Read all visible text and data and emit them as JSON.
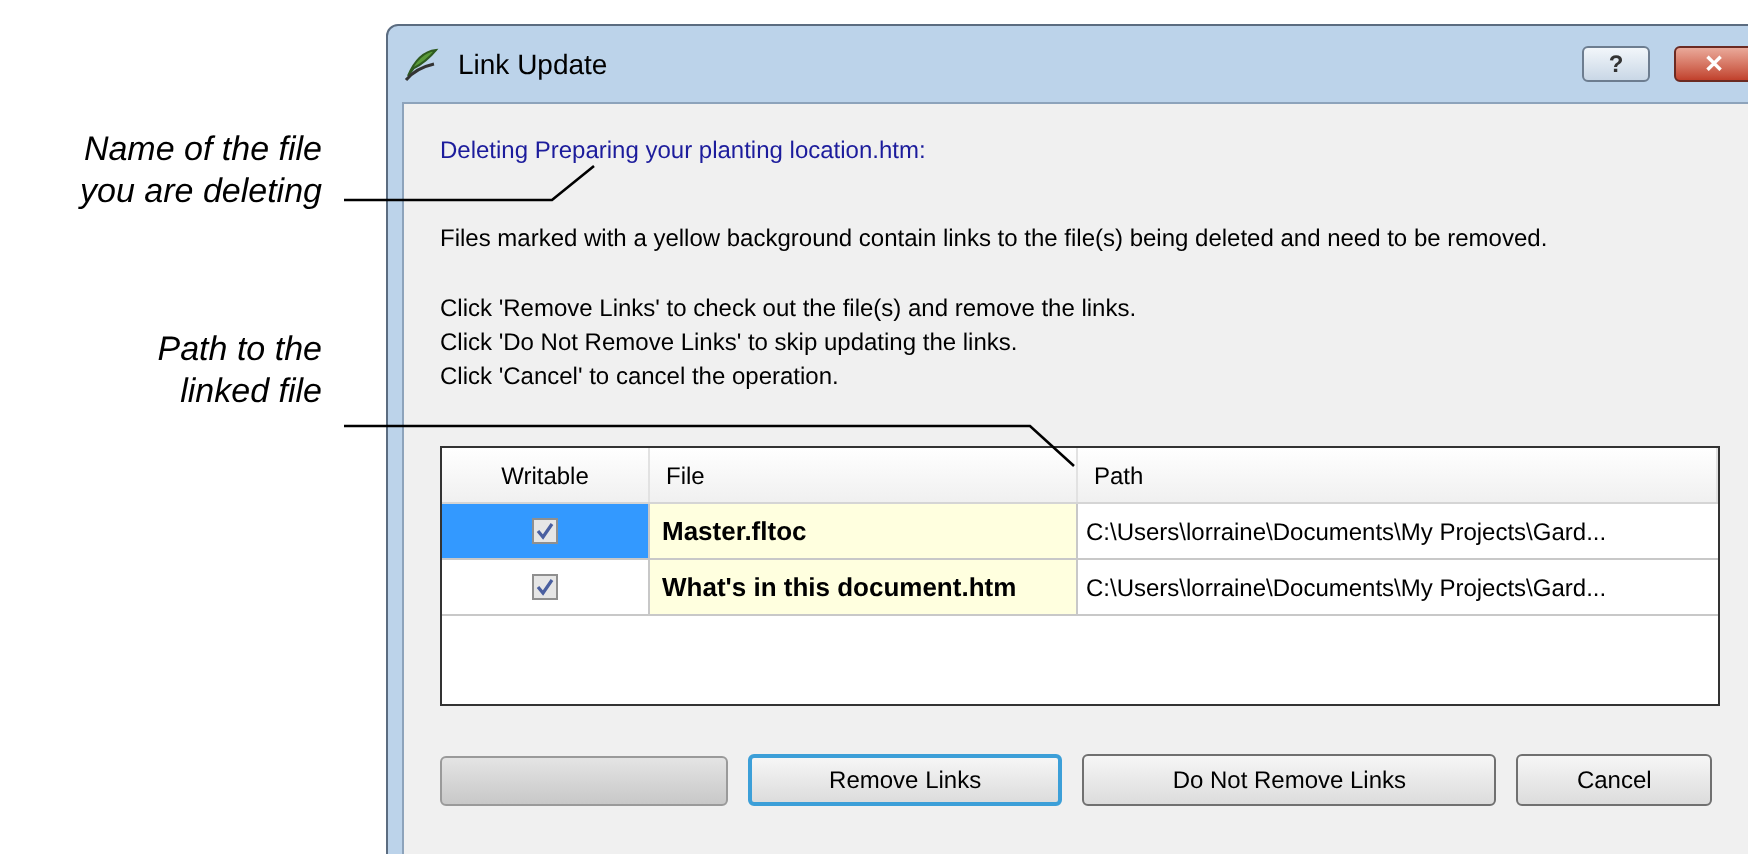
{
  "callouts": [
    "Name of the file\nyou are deleting",
    "Path to the\nlinked file"
  ],
  "window": {
    "title": "Link Update",
    "controls": [
      "?",
      "✕"
    ]
  },
  "deleting": "Deleting Preparing your planting location.htm:",
  "info": "Files marked with a yellow background contain links to the file(s) being deleted and need to be removed.",
  "instructions": [
    "Click 'Remove Links' to check out the file(s) and remove the links.",
    "Click 'Do Not Remove Links' to skip updating the links.",
    "Click 'Cancel' to cancel the operation."
  ],
  "table": {
    "columns": [
      "Writable",
      "File",
      "Path"
    ],
    "rows": [
      {
        "selected": true,
        "checked": true,
        "highlighted": true,
        "file": "Master.fltoc",
        "path": "C:\\Users\\lorraine\\Documents\\My Projects\\Gard..."
      },
      {
        "selected": false,
        "checked": true,
        "highlighted": true,
        "file": "What's in this document.htm",
        "path": "C:\\Users\\lorraine\\Documents\\My Projects\\Gard..."
      }
    ]
  },
  "blank_button": {
    "disabled": true
  },
  "buttons": [
    {
      "label": "Remove Links",
      "focused": true
    },
    {
      "label": "Do Not Remove Links",
      "focused": false
    },
    {
      "label": "Cancel",
      "focused": false
    }
  ]
}
